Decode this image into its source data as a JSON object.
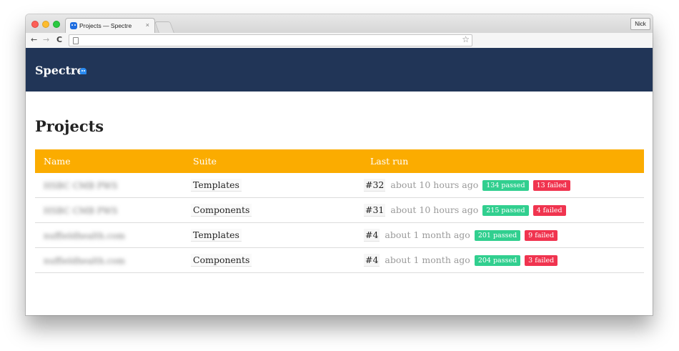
{
  "browser": {
    "tab_title": "Projects — Spectre",
    "tab_close": "×",
    "profile_name": "Nick",
    "nav": {
      "back": "←",
      "forward": "→",
      "reload": "C"
    },
    "bookmark_star": "☆"
  },
  "header": {
    "brand": "Spectre"
  },
  "page": {
    "title": "Projects"
  },
  "table": {
    "columns": [
      "Name",
      "Suite",
      "Last run"
    ],
    "rows": [
      {
        "name": "HSBC CMB PWS",
        "suite": "Templates",
        "run": "#32",
        "time": "about 10 hours ago",
        "passed": "134 passed",
        "failed": "13 failed"
      },
      {
        "name": "HSBC CMB PWS",
        "suite": "Components",
        "run": "#31",
        "time": "about 10 hours ago",
        "passed": "215 passed",
        "failed": "4 failed"
      },
      {
        "name": "nuffieldhealth.com",
        "suite": "Templates",
        "run": "#4",
        "time": "about 1 month ago",
        "passed": "201 passed",
        "failed": "9 failed"
      },
      {
        "name": "nuffieldhealth.com",
        "suite": "Components",
        "run": "#4",
        "time": "about 1 month ago",
        "passed": "204 passed",
        "failed": "3 failed"
      }
    ]
  },
  "colors": {
    "header_bg": "#213557",
    "table_head_bg": "#fbac00",
    "pass": "#31cf8f",
    "fail": "#f0344f"
  }
}
